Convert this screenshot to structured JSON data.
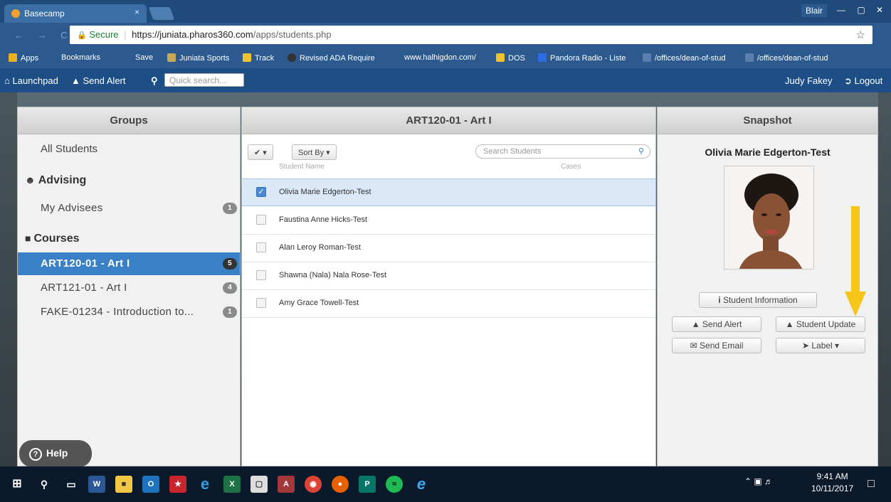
{
  "browser": {
    "tab_title": "Basecamp",
    "tab_close": "×",
    "window_user": "Blair",
    "win_min": "—",
    "win_max": "▢",
    "win_close": "✕",
    "nav_glyphs": "← → C",
    "secure_label": "Secure",
    "url_domain": "https://juniata.pharos360.com",
    "url_path": "/apps/students.php",
    "star": "☆"
  },
  "bookmarks": [
    {
      "label": "Apps",
      "color": "#e8b021"
    },
    {
      "label": "Bookmarks",
      "color": ""
    },
    {
      "label": "Save",
      "color": ""
    },
    {
      "label": "Juniata Sports",
      "color": "#c8a95a"
    },
    {
      "label": "Track",
      "color": "#f1c232"
    },
    {
      "label": "Revised ADA Require",
      "color": "#333333"
    },
    {
      "label": "www.halhigdon.com/",
      "color": ""
    },
    {
      "label": "DOS",
      "color": "#f1c232"
    },
    {
      "label": "Pandora Radio - Liste",
      "color": "#2e6be6"
    },
    {
      "label": "/offices/dean-of-stud",
      "color": "#5a7fae"
    },
    {
      "label": "/offices/dean-of-stud",
      "color": "#5a7fae"
    }
  ],
  "appbar": {
    "launchpad": "Launchpad",
    "send_alert": "Send Alert",
    "search_placeholder": "Quick search...",
    "user": "Judy Fakey",
    "logout": "Logout"
  },
  "groups": {
    "title": "Groups",
    "all_students": "All Students",
    "advising_header": "Advising",
    "advising_items": [
      {
        "label": "My Advisees",
        "count": "1"
      }
    ],
    "courses_header": "Courses",
    "course_items": [
      {
        "label": "ART120-01 - Art I",
        "count": "5",
        "active": true
      },
      {
        "label": "ART121-01 - Art I",
        "count": "4",
        "active": false
      },
      {
        "label": "FAKE-01234 - Introduction to...",
        "count": "1",
        "active": false
      }
    ],
    "help": "Help"
  },
  "course": {
    "title": "ART120-01 - Art I",
    "check_menu": "✔ ▾",
    "sort_by": "Sort By ▾",
    "search_placeholder": "Search Students",
    "col_student_name": "Student Name",
    "col_cases": "Cases",
    "students": [
      {
        "name": "Olivia Marie Edgerton-Test",
        "checked": true
      },
      {
        "name": "Faustina Anne Hicks-Test",
        "checked": false
      },
      {
        "name": "Alan Leroy Roman-Test",
        "checked": false
      },
      {
        "name": "Shawna (Nala) Nala Rose-Test",
        "checked": false
      },
      {
        "name": "Amy Grace Towell-Test",
        "checked": false
      }
    ]
  },
  "snapshot": {
    "title": "Snapshot",
    "student_name": "Olivia Marie Edgerton-Test",
    "student_info": "Student Information",
    "send_alert": "Send Alert",
    "student_update": "Student Update",
    "send_email": "Send Email",
    "label": "Label ▾"
  },
  "taskbar": {
    "time": "9:41 AM",
    "date": "10/11/2017",
    "word_label": "W",
    "excel_label": "X",
    "access_label": "A",
    "publisher_label": "P"
  },
  "colors": {
    "accent": "#3a80c6",
    "annotation_arrow": "#f5c518"
  }
}
